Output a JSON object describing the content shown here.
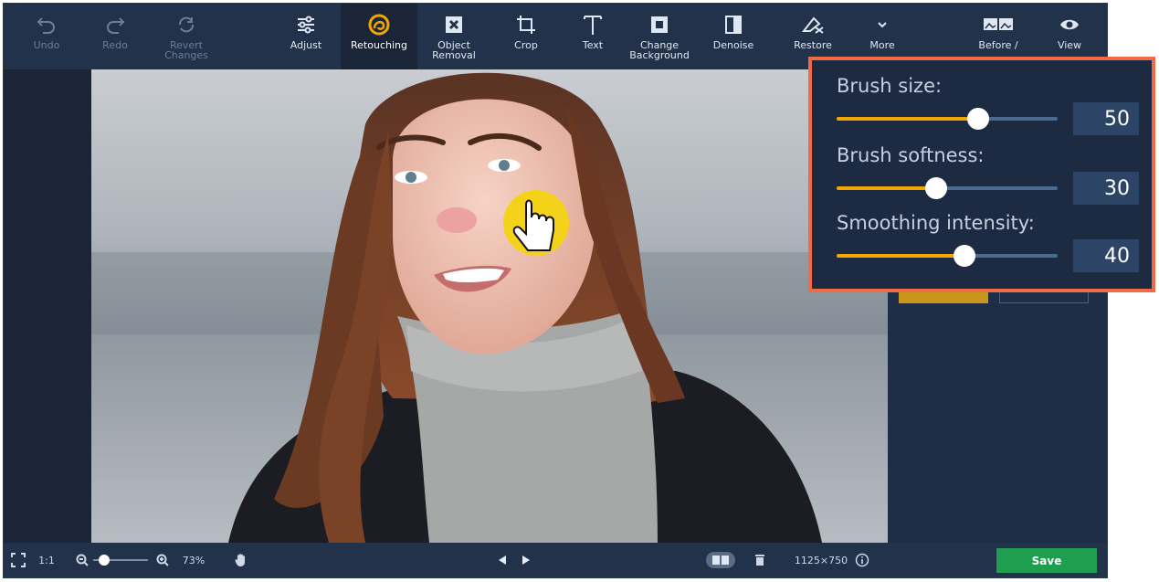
{
  "toolbar": {
    "undo": "Undo",
    "redo": "Redo",
    "revert": "Revert\nChanges",
    "adjust": "Adjust",
    "retouching": "Retouching",
    "object_removal": "Object\nRemoval",
    "crop": "Crop",
    "text": "Text",
    "change_background": "Change\nBackground",
    "denoise": "Denoise",
    "restore": "Restore",
    "more": "More",
    "before_after": "Before /",
    "view": "View"
  },
  "brush_panel": {
    "brush_size": {
      "label": "Brush size:",
      "value": "50",
      "level": 0.64
    },
    "brush_softness": {
      "label": "Brush softness:",
      "value": "30",
      "level": 0.45
    },
    "smoothing_intensity": {
      "label": "Smoothing intensity:",
      "value": "40",
      "level": 0.58
    }
  },
  "bottombar": {
    "one_to_one": "1:1",
    "zoom": "73%",
    "zoom_level": 0.2,
    "dimensions": "1125×750",
    "save": "Save"
  },
  "colors": {
    "accent": "#f0a800",
    "highlight_border": "#f06a48",
    "save_green": "#1e9e4e",
    "cursor_yellow": "#f5d21a"
  }
}
